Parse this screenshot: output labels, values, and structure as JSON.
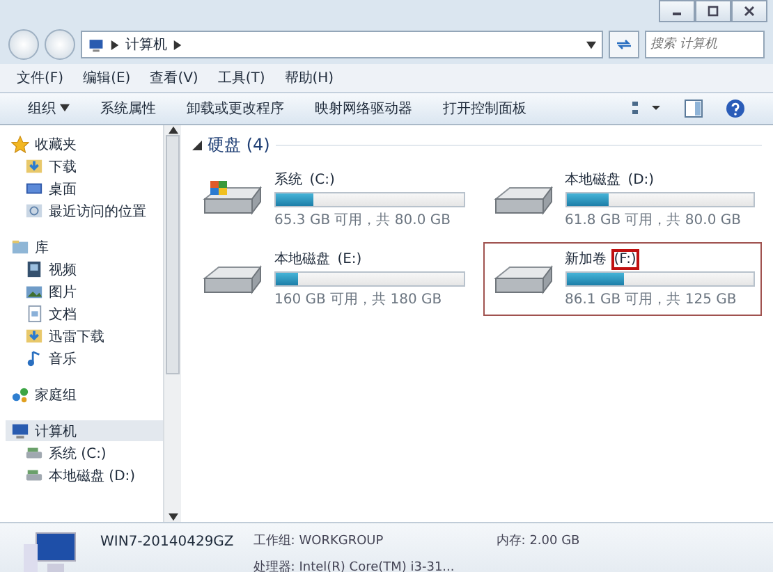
{
  "address_bar": {
    "path": [
      "计算机"
    ]
  },
  "search": {
    "placeholder": "搜索 计算机"
  },
  "menu": [
    "文件(F)",
    "编辑(E)",
    "查看(V)",
    "工具(T)",
    "帮助(H)"
  ],
  "toolbar": [
    {
      "label": "组织",
      "kind": "dropdown"
    },
    {
      "label": "系统属性",
      "kind": "plain"
    },
    {
      "label": "卸载或更改程序",
      "kind": "plain"
    },
    {
      "label": "映射网络驱动器",
      "kind": "plain"
    },
    {
      "label": "打开控制面板",
      "kind": "plain"
    }
  ],
  "sidebar": [
    {
      "label": "收藏夹",
      "selected": false,
      "children": [
        {
          "label": "下载",
          "selected": false
        },
        {
          "label": "桌面",
          "selected": false
        },
        {
          "label": "最近访问的位置",
          "selected": false
        }
      ]
    },
    {
      "label": "库",
      "selected": false,
      "children": [
        {
          "label": "视频",
          "selected": false
        },
        {
          "label": "图片",
          "selected": false
        },
        {
          "label": "文档",
          "selected": false
        },
        {
          "label": "迅雷下载",
          "selected": false
        },
        {
          "label": "音乐",
          "selected": false
        }
      ]
    },
    {
      "label": "家庭组",
      "selected": false
    },
    {
      "label": "计算机",
      "selected": true,
      "children": [
        {
          "label": "系统 (C:)",
          "selected": false
        },
        {
          "label": "本地磁盘 (D:)",
          "selected": false
        }
      ]
    }
  ],
  "section": {
    "title": "硬盘 (4)",
    "expanded": true
  },
  "drives": [
    {
      "name": "系统 ",
      "letter": "(C:)",
      "system": true,
      "level": 0.2,
      "free": "65.3 GB 可用，共 80.0 GB",
      "selected": false,
      "highlighted": false
    },
    {
      "name": "本地磁盘 ",
      "letter": "(D:)",
      "system": false,
      "level": 0.23,
      "free": "61.8 GB 可用，共 80.0 GB",
      "selected": false,
      "highlighted": false
    },
    {
      "name": "本地磁盘 ",
      "letter": "(E:)",
      "system": false,
      "level": 0.12,
      "free": "160 GB 可用，共 180 GB",
      "selected": false,
      "highlighted": false
    },
    {
      "name": "新加卷 ",
      "letter": "(F:)",
      "system": false,
      "level": 0.31,
      "free": "86.1 GB 可用，共 125 GB",
      "selected": true,
      "highlighted": true
    }
  ],
  "details": {
    "computer_name": "WIN7-20140429GZ",
    "fields": [
      {
        "label": "工作组:",
        "value": "WORKGROUP"
      },
      {
        "label": "内存:",
        "value": "2.00 GB"
      },
      {
        "label": "处理器:",
        "value": "Intel(R) Core(TM) i3-31..."
      }
    ]
  }
}
